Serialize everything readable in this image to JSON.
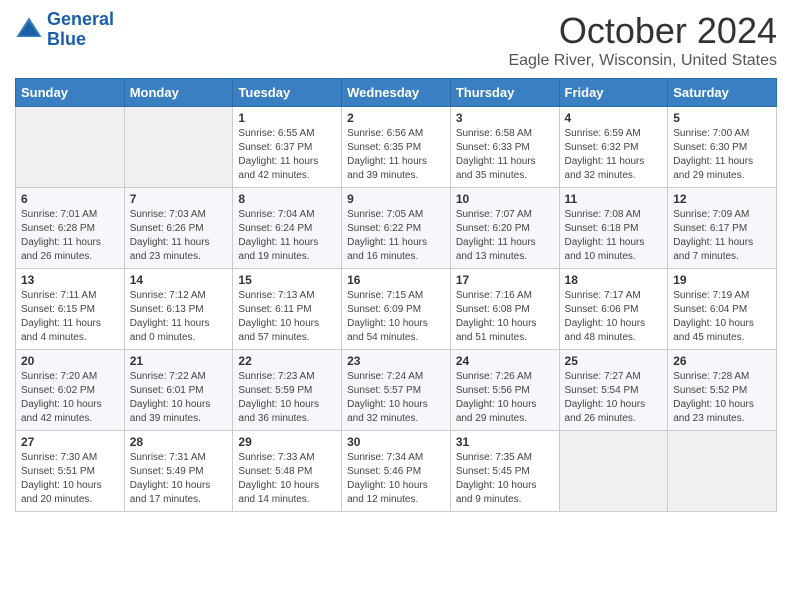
{
  "header": {
    "logo_line1": "General",
    "logo_line2": "Blue",
    "month_title": "October 2024",
    "subtitle": "Eagle River, Wisconsin, United States"
  },
  "days_of_week": [
    "Sunday",
    "Monday",
    "Tuesday",
    "Wednesday",
    "Thursday",
    "Friday",
    "Saturday"
  ],
  "weeks": [
    [
      {
        "day": "",
        "sunrise": "",
        "sunset": "",
        "daylight": ""
      },
      {
        "day": "",
        "sunrise": "",
        "sunset": "",
        "daylight": ""
      },
      {
        "day": "1",
        "sunrise": "Sunrise: 6:55 AM",
        "sunset": "Sunset: 6:37 PM",
        "daylight": "Daylight: 11 hours and 42 minutes."
      },
      {
        "day": "2",
        "sunrise": "Sunrise: 6:56 AM",
        "sunset": "Sunset: 6:35 PM",
        "daylight": "Daylight: 11 hours and 39 minutes."
      },
      {
        "day": "3",
        "sunrise": "Sunrise: 6:58 AM",
        "sunset": "Sunset: 6:33 PM",
        "daylight": "Daylight: 11 hours and 35 minutes."
      },
      {
        "day": "4",
        "sunrise": "Sunrise: 6:59 AM",
        "sunset": "Sunset: 6:32 PM",
        "daylight": "Daylight: 11 hours and 32 minutes."
      },
      {
        "day": "5",
        "sunrise": "Sunrise: 7:00 AM",
        "sunset": "Sunset: 6:30 PM",
        "daylight": "Daylight: 11 hours and 29 minutes."
      }
    ],
    [
      {
        "day": "6",
        "sunrise": "Sunrise: 7:01 AM",
        "sunset": "Sunset: 6:28 PM",
        "daylight": "Daylight: 11 hours and 26 minutes."
      },
      {
        "day": "7",
        "sunrise": "Sunrise: 7:03 AM",
        "sunset": "Sunset: 6:26 PM",
        "daylight": "Daylight: 11 hours and 23 minutes."
      },
      {
        "day": "8",
        "sunrise": "Sunrise: 7:04 AM",
        "sunset": "Sunset: 6:24 PM",
        "daylight": "Daylight: 11 hours and 19 minutes."
      },
      {
        "day": "9",
        "sunrise": "Sunrise: 7:05 AM",
        "sunset": "Sunset: 6:22 PM",
        "daylight": "Daylight: 11 hours and 16 minutes."
      },
      {
        "day": "10",
        "sunrise": "Sunrise: 7:07 AM",
        "sunset": "Sunset: 6:20 PM",
        "daylight": "Daylight: 11 hours and 13 minutes."
      },
      {
        "day": "11",
        "sunrise": "Sunrise: 7:08 AM",
        "sunset": "Sunset: 6:18 PM",
        "daylight": "Daylight: 11 hours and 10 minutes."
      },
      {
        "day": "12",
        "sunrise": "Sunrise: 7:09 AM",
        "sunset": "Sunset: 6:17 PM",
        "daylight": "Daylight: 11 hours and 7 minutes."
      }
    ],
    [
      {
        "day": "13",
        "sunrise": "Sunrise: 7:11 AM",
        "sunset": "Sunset: 6:15 PM",
        "daylight": "Daylight: 11 hours and 4 minutes."
      },
      {
        "day": "14",
        "sunrise": "Sunrise: 7:12 AM",
        "sunset": "Sunset: 6:13 PM",
        "daylight": "Daylight: 11 hours and 0 minutes."
      },
      {
        "day": "15",
        "sunrise": "Sunrise: 7:13 AM",
        "sunset": "Sunset: 6:11 PM",
        "daylight": "Daylight: 10 hours and 57 minutes."
      },
      {
        "day": "16",
        "sunrise": "Sunrise: 7:15 AM",
        "sunset": "Sunset: 6:09 PM",
        "daylight": "Daylight: 10 hours and 54 minutes."
      },
      {
        "day": "17",
        "sunrise": "Sunrise: 7:16 AM",
        "sunset": "Sunset: 6:08 PM",
        "daylight": "Daylight: 10 hours and 51 minutes."
      },
      {
        "day": "18",
        "sunrise": "Sunrise: 7:17 AM",
        "sunset": "Sunset: 6:06 PM",
        "daylight": "Daylight: 10 hours and 48 minutes."
      },
      {
        "day": "19",
        "sunrise": "Sunrise: 7:19 AM",
        "sunset": "Sunset: 6:04 PM",
        "daylight": "Daylight: 10 hours and 45 minutes."
      }
    ],
    [
      {
        "day": "20",
        "sunrise": "Sunrise: 7:20 AM",
        "sunset": "Sunset: 6:02 PM",
        "daylight": "Daylight: 10 hours and 42 minutes."
      },
      {
        "day": "21",
        "sunrise": "Sunrise: 7:22 AM",
        "sunset": "Sunset: 6:01 PM",
        "daylight": "Daylight: 10 hours and 39 minutes."
      },
      {
        "day": "22",
        "sunrise": "Sunrise: 7:23 AM",
        "sunset": "Sunset: 5:59 PM",
        "daylight": "Daylight: 10 hours and 36 minutes."
      },
      {
        "day": "23",
        "sunrise": "Sunrise: 7:24 AM",
        "sunset": "Sunset: 5:57 PM",
        "daylight": "Daylight: 10 hours and 32 minutes."
      },
      {
        "day": "24",
        "sunrise": "Sunrise: 7:26 AM",
        "sunset": "Sunset: 5:56 PM",
        "daylight": "Daylight: 10 hours and 29 minutes."
      },
      {
        "day": "25",
        "sunrise": "Sunrise: 7:27 AM",
        "sunset": "Sunset: 5:54 PM",
        "daylight": "Daylight: 10 hours and 26 minutes."
      },
      {
        "day": "26",
        "sunrise": "Sunrise: 7:28 AM",
        "sunset": "Sunset: 5:52 PM",
        "daylight": "Daylight: 10 hours and 23 minutes."
      }
    ],
    [
      {
        "day": "27",
        "sunrise": "Sunrise: 7:30 AM",
        "sunset": "Sunset: 5:51 PM",
        "daylight": "Daylight: 10 hours and 20 minutes."
      },
      {
        "day": "28",
        "sunrise": "Sunrise: 7:31 AM",
        "sunset": "Sunset: 5:49 PM",
        "daylight": "Daylight: 10 hours and 17 minutes."
      },
      {
        "day": "29",
        "sunrise": "Sunrise: 7:33 AM",
        "sunset": "Sunset: 5:48 PM",
        "daylight": "Daylight: 10 hours and 14 minutes."
      },
      {
        "day": "30",
        "sunrise": "Sunrise: 7:34 AM",
        "sunset": "Sunset: 5:46 PM",
        "daylight": "Daylight: 10 hours and 12 minutes."
      },
      {
        "day": "31",
        "sunrise": "Sunrise: 7:35 AM",
        "sunset": "Sunset: 5:45 PM",
        "daylight": "Daylight: 10 hours and 9 minutes."
      },
      {
        "day": "",
        "sunrise": "",
        "sunset": "",
        "daylight": ""
      },
      {
        "day": "",
        "sunrise": "",
        "sunset": "",
        "daylight": ""
      }
    ]
  ]
}
